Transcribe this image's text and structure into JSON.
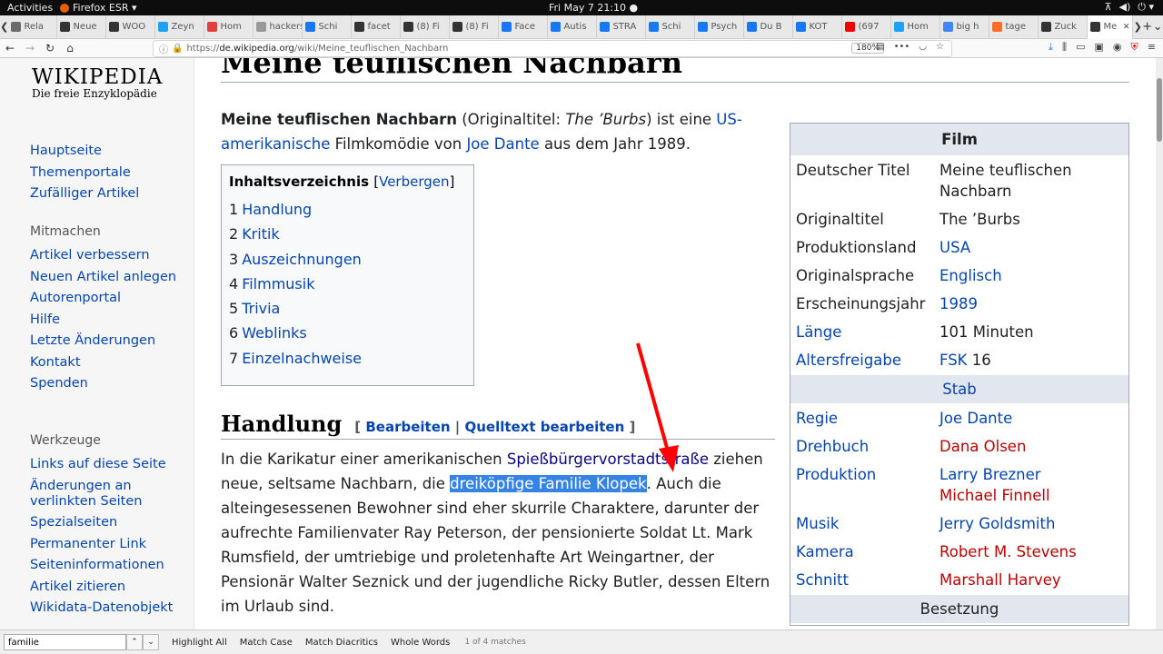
{
  "system": {
    "activities": "Activities",
    "app": "Firefox ESR ▾",
    "clock": "Fri May 7  21:10 ●"
  },
  "tabs": [
    {
      "icon": "mail-icon",
      "label": "Rela",
      "color": "#6b6b6b"
    },
    {
      "icon": "feed-icon",
      "label": "Neue",
      "color": "#333"
    },
    {
      "icon": "wikipedia-icon",
      "label": "WOO",
      "color": "#333"
    },
    {
      "icon": "twitter-icon",
      "label": "Zeyn",
      "color": "#1da1f2"
    },
    {
      "icon": "home-icon",
      "label": "Hom",
      "color": "#e04040"
    },
    {
      "icon": "hacker-icon",
      "label": "hackers",
      "color": "#999"
    },
    {
      "icon": "facebook-icon",
      "label": "Schi",
      "color": "#1877f2"
    },
    {
      "icon": "feed-icon",
      "label": "facet",
      "color": "#333"
    },
    {
      "icon": "feed-icon",
      "label": "(8) Fi",
      "color": "#333"
    },
    {
      "icon": "feed-icon",
      "label": "(8) Fi",
      "color": "#333"
    },
    {
      "icon": "facebook-icon",
      "label": "Face",
      "color": "#1877f2"
    },
    {
      "icon": "facebook-icon",
      "label": "Autis",
      "color": "#1877f2"
    },
    {
      "icon": "facebook-icon",
      "label": "STRA",
      "color": "#1877f2"
    },
    {
      "icon": "facebook-icon",
      "label": "Schi",
      "color": "#1877f2"
    },
    {
      "icon": "facebook-icon",
      "label": "Psych",
      "color": "#1877f2"
    },
    {
      "icon": "facebook-icon",
      "label": "Du B",
      "color": "#1877f2"
    },
    {
      "icon": "facebook-icon",
      "label": "KOT",
      "color": "#1877f2"
    },
    {
      "icon": "youtube-icon",
      "label": "(697",
      "color": "#e00"
    },
    {
      "icon": "twitter-icon",
      "label": "Hom",
      "color": "#1da1f2"
    },
    {
      "icon": "google-icon",
      "label": "big h",
      "color": "#4285f4"
    },
    {
      "icon": "gitlab-icon",
      "label": "tage",
      "color": "#fc6d26"
    },
    {
      "icon": "wikipedia-icon",
      "label": "Zuck",
      "color": "#333"
    },
    {
      "icon": "wikipedia-icon",
      "label": "Me",
      "color": "#333",
      "active": true
    }
  ],
  "url": {
    "prefix": "https://",
    "domain": "de.wikipedia.org",
    "path": "/wiki/Meine_teuflischen_Nachbarn",
    "zoom": "180%"
  },
  "logo": {
    "title": "WIKIPEDIA",
    "subtitle": "Die freie Enzyklopädie"
  },
  "sidebar": {
    "main": [
      "Hauptseite",
      "Themenportale",
      "Zufälliger Artikel"
    ],
    "mitmachen_title": "Mitmachen",
    "mitmachen": [
      "Artikel verbessern",
      "Neuen Artikel anlegen",
      "Autorenportal",
      "Hilfe",
      "Letzte Änderungen",
      "Kontakt",
      "Spenden"
    ],
    "werkzeuge_title": "Werkzeuge",
    "werkzeuge": [
      "Links auf diese Seite",
      "Änderungen an verlinkten Seiten",
      "Spezialseiten",
      "Permanenter Link",
      "Seiteninformationen",
      "Artikel zitieren",
      "Wikidata-Datenobjekt"
    ]
  },
  "article": {
    "title": "Meine teuflischen Nachbarn",
    "intro": {
      "bold": "Meine teuflischen Nachbarn",
      "t1": " (Originaltitel: ",
      "orig": "The ’Burbs",
      "t2": ") ist eine ",
      "link1": "US-amerikanische",
      "t3": " Filmkomödie von ",
      "link2": "Joe Dante",
      "t4": " aus dem Jahr 1989."
    },
    "toc": {
      "title": "Inhaltsverzeichnis",
      "hide": "Verbergen",
      "items": [
        {
          "n": "1",
          "label": "Handlung"
        },
        {
          "n": "2",
          "label": "Kritik"
        },
        {
          "n": "3",
          "label": "Auszeichnungen"
        },
        {
          "n": "4",
          "label": "Filmmusik"
        },
        {
          "n": "5",
          "label": "Trivia"
        },
        {
          "n": "6",
          "label": "Weblinks"
        },
        {
          "n": "7",
          "label": "Einzelnachweise"
        }
      ]
    },
    "section": {
      "title": "Handlung",
      "edit": "Bearbeiten",
      "source": "Quelltext bearbeiten"
    },
    "story": {
      "t1": "In die Karikatur einer amerikanischen ",
      "link": "Spießbürgervorstadtstraße",
      "t2": " ziehen neue, seltsame Nachbarn, die ",
      "selected": "dreiköpfige Familie Klopek",
      "t3": ". Auch die alteingesessenen Bewohner sind eher skurrile Charaktere, darunter der aufrechte Familienvater Ray Peterson, der pensionierte Soldat Lt. Mark Rumsfield, der umtriebige und proletenhafte Art Weingartner, der Pensionär Walter Seznick und der jugendliche Ricky Butler, dessen Eltern im Urlaub sind."
    }
  },
  "infobox": {
    "title": "Film",
    "rows": [
      {
        "k": "Deutscher Titel",
        "v": "Meine teuflischen Nachbarn"
      },
      {
        "k": "Originaltitel",
        "v": "The ’Burbs"
      },
      {
        "k": "Produktionsland",
        "v": "USA",
        "link": true
      },
      {
        "k": "Originalsprache",
        "v": "Englisch",
        "link": true
      },
      {
        "k": "Erscheinungsjahr",
        "v": "1989",
        "link": true
      },
      {
        "k": "Länge",
        "v": "101 Minuten",
        "klink": true
      },
      {
        "k": "Altersfreigabe",
        "v": "FSK",
        "v2": " 16",
        "klink": true,
        "link": true
      }
    ],
    "stab_title": "Stab",
    "stab": [
      {
        "k": "Regie",
        "v": [
          "Joe Dante"
        ],
        "red": [
          false
        ]
      },
      {
        "k": "Drehbuch",
        "v": [
          "Dana Olsen"
        ],
        "red": [
          true
        ]
      },
      {
        "k": "Produktion",
        "v": [
          "Larry Brezner",
          "Michael Finnell"
        ],
        "red": [
          false,
          true
        ]
      },
      {
        "k": "Musik",
        "v": [
          "Jerry Goldsmith"
        ],
        "red": [
          false
        ]
      },
      {
        "k": "Kamera",
        "v": [
          "Robert M. Stevens"
        ],
        "red": [
          true
        ]
      },
      {
        "k": "Schnitt",
        "v": [
          "Marshall Harvey"
        ],
        "red": [
          true
        ]
      }
    ],
    "besetzung": "Besetzung"
  },
  "findbar": {
    "value": "familie",
    "highlight": "Highlight All",
    "matchcase": "Match Case",
    "diacritics": "Match Diacritics",
    "whole": "Whole Words",
    "status": "1 of 4 matches"
  },
  "colors": {
    "link": "#0645ad",
    "redlink": "#ba0000",
    "selection": "#3584e4",
    "arrow": "#ff0000"
  }
}
